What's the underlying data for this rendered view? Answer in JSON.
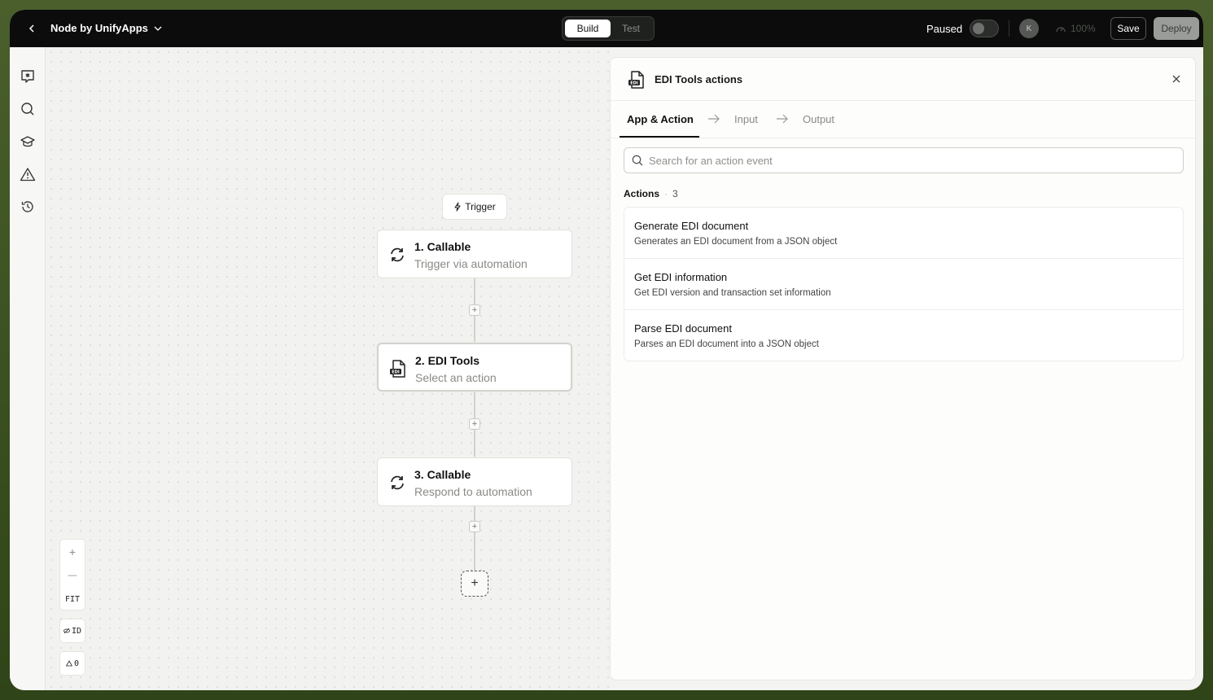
{
  "topbar": {
    "app_name": "Node by UnifyApps",
    "mode_build": "Build",
    "mode_test": "Test",
    "status_label": "Paused",
    "avatar_initial": "K",
    "zoom_level": "100%",
    "save_label": "Save",
    "deploy_label": "Deploy"
  },
  "rail": {
    "icons": [
      "ai-assistant-icon",
      "search-icon",
      "learn-icon",
      "alert-icon",
      "history-icon"
    ]
  },
  "canvas": {
    "trigger_label": "Trigger",
    "nodes": [
      {
        "title": "1. Callable",
        "subtitle": "Trigger via automation"
      },
      {
        "title": "2. EDI Tools",
        "subtitle": "Select an action"
      },
      {
        "title": "3. Callable",
        "subtitle": "Respond to automation"
      }
    ],
    "controls": {
      "zoom_in": "+",
      "zoom_out": "—",
      "fit": "FIT",
      "id_toggle": "ID",
      "warnings_count": "0"
    }
  },
  "panel": {
    "title": "EDI Tools actions",
    "tabs": [
      "App & Action",
      "Input",
      "Output"
    ],
    "search_placeholder": "Search for an action event",
    "actions_label": "Actions",
    "actions_count": "3",
    "actions": [
      {
        "title": "Generate EDI document",
        "description": "Generates an EDI document from a JSON object"
      },
      {
        "title": "Get EDI information",
        "description": "Get EDI version and transaction set information"
      },
      {
        "title": "Parse EDI document",
        "description": "Parses an EDI document into a JSON object"
      }
    ]
  },
  "colors": {
    "topbar_bg": "#0b0c0b",
    "frame_bg": "#4a5f2c",
    "canvas_bg": "#f2f2f0"
  }
}
